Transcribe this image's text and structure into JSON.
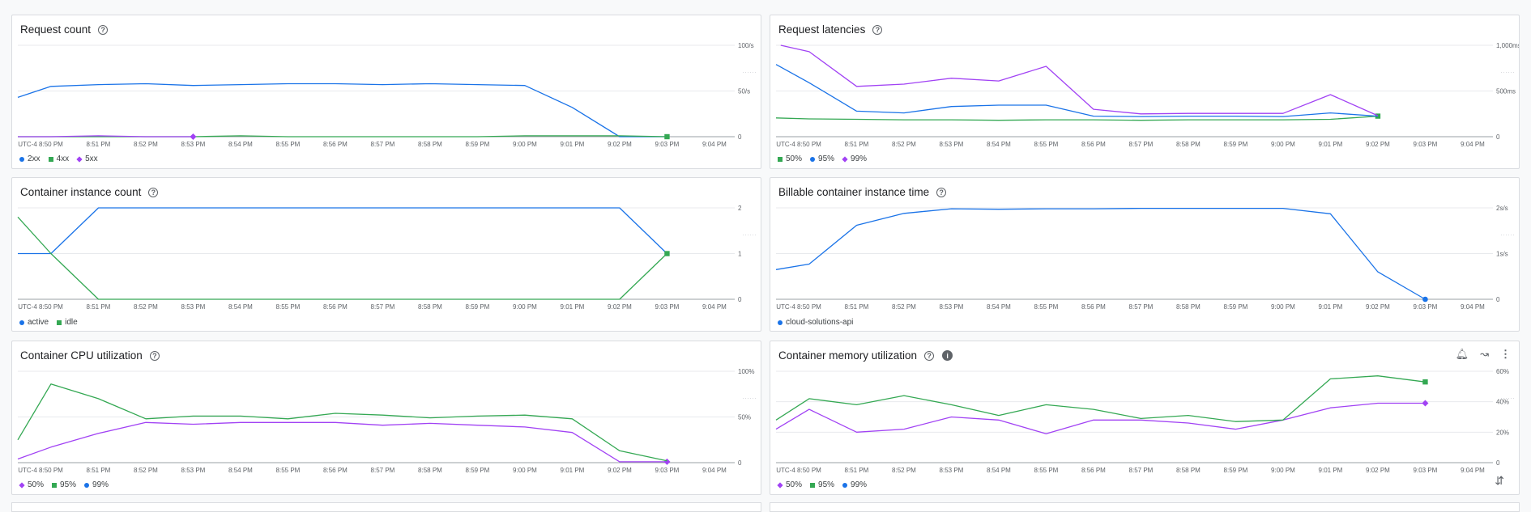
{
  "charts": [
    {
      "title": "Request count",
      "type": "line",
      "x_labels": [
        "UTC-4",
        "8:50 PM",
        "8:51 PM",
        "8:52 PM",
        "8:53 PM",
        "8:54 PM",
        "8:55 PM",
        "8:56 PM",
        "8:57 PM",
        "8:58 PM",
        "8:59 PM",
        "9:00 PM",
        "9:01 PM",
        "9:02 PM",
        "9:03 PM",
        "9:04 PM"
      ],
      "y_ticks": [
        {
          "v": 0,
          "label": "0"
        },
        {
          "v": 50,
          "label": "50/s"
        },
        {
          "v": 100,
          "label": "100/s"
        }
      ],
      "ylim": [
        0,
        100
      ],
      "series": [
        {
          "name": "2xx",
          "color": "#1a73e8",
          "marker": "circle",
          "x": [
            -0.8,
            0,
            1,
            2,
            3,
            4,
            5,
            6,
            7,
            8,
            9,
            10,
            11,
            12,
            13
          ],
          "y": [
            43,
            55,
            57,
            58,
            56,
            57,
            58,
            58,
            57,
            58,
            57,
            56,
            32,
            0,
            0
          ],
          "end_marker": false
        },
        {
          "name": "4xx",
          "color": "#34a853",
          "marker": "square",
          "x": [
            -0.8,
            0,
            1,
            2,
            3,
            4,
            5,
            6,
            7,
            8,
            9,
            10,
            11,
            12,
            13
          ],
          "y": [
            0,
            0,
            0,
            0,
            0,
            1,
            0,
            0,
            0,
            0,
            0,
            1,
            1,
            1,
            0
          ],
          "end_marker": true
        },
        {
          "name": "5xx",
          "color": "#a142f4",
          "marker": "diamond",
          "x": [
            -0.8,
            0,
            1,
            2,
            3
          ],
          "y": [
            0,
            0,
            1,
            0,
            0
          ],
          "end_marker": true
        }
      ]
    },
    {
      "title": "Request latencies",
      "type": "line",
      "x_labels": [
        "UTC-4",
        "8:50 PM",
        "8:51 PM",
        "8:52 PM",
        "8:53 PM",
        "8:54 PM",
        "8:55 PM",
        "8:56 PM",
        "8:57 PM",
        "8:58 PM",
        "8:59 PM",
        "9:00 PM",
        "9:01 PM",
        "9:02 PM",
        "9:03 PM",
        "9:04 PM"
      ],
      "y_ticks": [
        {
          "v": 0,
          "label": "0"
        },
        {
          "v": 500,
          "label": "500ms"
        },
        {
          "v": 1000,
          "label": "1,000ms"
        }
      ],
      "ylim": [
        0,
        1000
      ],
      "series": [
        {
          "name": "50%",
          "color": "#34a853",
          "marker": "square",
          "x": [
            -0.8,
            0,
            1,
            2,
            3,
            4,
            5,
            6,
            7,
            8,
            9,
            10,
            11,
            12
          ],
          "y": [
            205,
            195,
            190,
            185,
            185,
            180,
            185,
            185,
            180,
            185,
            185,
            185,
            190,
            225
          ],
          "end_marker": true
        },
        {
          "name": "95%",
          "color": "#1a73e8",
          "marker": "circle",
          "x": [
            -0.8,
            0,
            1,
            2,
            3,
            4,
            5,
            6,
            7,
            8,
            9,
            10,
            11,
            12
          ],
          "y": [
            790,
            590,
            280,
            260,
            330,
            345,
            345,
            225,
            220,
            225,
            225,
            220,
            260,
            225
          ],
          "end_marker": false
        },
        {
          "name": "99%",
          "color": "#a142f4",
          "marker": "diamond",
          "x": [
            -0.6,
            0,
            1,
            2,
            3,
            4,
            5,
            6,
            7,
            8,
            9,
            10,
            11,
            12
          ],
          "y": [
            1000,
            930,
            550,
            575,
            640,
            610,
            770,
            300,
            250,
            255,
            255,
            255,
            460,
            230
          ],
          "end_marker": false
        }
      ]
    },
    {
      "title": "Container instance count",
      "type": "line",
      "x_labels": [
        "UTC-4",
        "8:50 PM",
        "8:51 PM",
        "8:52 PM",
        "8:53 PM",
        "8:54 PM",
        "8:55 PM",
        "8:56 PM",
        "8:57 PM",
        "8:58 PM",
        "8:59 PM",
        "9:00 PM",
        "9:01 PM",
        "9:02 PM",
        "9:03 PM",
        "9:04 PM"
      ],
      "y_ticks": [
        {
          "v": 0,
          "label": "0"
        },
        {
          "v": 1,
          "label": "1"
        },
        {
          "v": 2,
          "label": "2"
        }
      ],
      "ylim": [
        0,
        2
      ],
      "series": [
        {
          "name": "active",
          "color": "#1a73e8",
          "marker": "circle",
          "x": [
            -0.8,
            0,
            1,
            2,
            3,
            4,
            5,
            6,
            7,
            8,
            9,
            10,
            11,
            12,
            13
          ],
          "y": [
            1,
            1,
            2,
            2,
            2,
            2,
            2,
            2,
            2,
            2,
            2,
            2,
            2,
            2,
            1
          ],
          "end_marker": false
        },
        {
          "name": "idle",
          "color": "#34a853",
          "marker": "square",
          "x": [
            -0.8,
            0,
            1,
            2,
            3,
            4,
            5,
            6,
            7,
            8,
            9,
            10,
            11,
            12,
            13
          ],
          "y": [
            1.8,
            1,
            0,
            0,
            0,
            0,
            0,
            0,
            0,
            0,
            0,
            0,
            0,
            0,
            1
          ],
          "end_marker": true
        }
      ]
    },
    {
      "title": "Billable container instance time",
      "type": "line",
      "x_labels": [
        "UTC-4",
        "8:50 PM",
        "8:51 PM",
        "8:52 PM",
        "8:53 PM",
        "8:54 PM",
        "8:55 PM",
        "8:56 PM",
        "8:57 PM",
        "8:58 PM",
        "8:59 PM",
        "9:00 PM",
        "9:01 PM",
        "9:02 PM",
        "9:03 PM",
        "9:04 PM"
      ],
      "y_ticks": [
        {
          "v": 0,
          "label": "0"
        },
        {
          "v": 1,
          "label": "1s/s"
        },
        {
          "v": 2,
          "label": "2s/s"
        }
      ],
      "ylim": [
        0,
        2
      ],
      "series": [
        {
          "name": "cloud-solutions-api",
          "color": "#1a73e8",
          "marker": "circle",
          "x": [
            -0.8,
            0,
            1,
            2,
            3,
            4,
            5,
            6,
            7,
            8,
            9,
            10,
            11,
            12,
            13
          ],
          "y": [
            0.65,
            0.77,
            1.62,
            1.88,
            1.98,
            1.97,
            1.98,
            1.98,
            1.99,
            1.99,
            1.99,
            1.99,
            1.87,
            0.6,
            0
          ],
          "end_marker": true
        }
      ]
    },
    {
      "title": "Container CPU utilization",
      "type": "line",
      "x_labels": [
        "UTC-4",
        "8:50 PM",
        "8:51 PM",
        "8:52 PM",
        "8:53 PM",
        "8:54 PM",
        "8:55 PM",
        "8:56 PM",
        "8:57 PM",
        "8:58 PM",
        "8:59 PM",
        "9:00 PM",
        "9:01 PM",
        "9:02 PM",
        "9:03 PM",
        "9:04 PM"
      ],
      "y_ticks": [
        {
          "v": 0,
          "label": "0"
        },
        {
          "v": 50,
          "label": "50%"
        },
        {
          "v": 100,
          "label": "100%"
        }
      ],
      "ylim": [
        0,
        100
      ],
      "series": [
        {
          "name": "50%",
          "color": "#a142f4",
          "marker": "diamond",
          "x": [
            -0.8,
            0,
            1,
            2,
            3,
            4,
            5,
            6,
            7,
            8,
            9,
            10,
            11,
            12,
            13
          ],
          "y": [
            4,
            17,
            32,
            44,
            42,
            44,
            44,
            44,
            41,
            43,
            41,
            39,
            33,
            1,
            1
          ],
          "end_marker": true
        },
        {
          "name": "95%",
          "color": "#34a853",
          "marker": "square",
          "x": [
            -0.8,
            0,
            1,
            2,
            3,
            4,
            5,
            6,
            7,
            8,
            9,
            10,
            11,
            12,
            13
          ],
          "y": [
            25,
            86,
            70,
            48,
            51,
            51,
            48,
            54,
            52,
            49,
            51,
            52,
            48,
            13,
            2
          ],
          "end_marker": false
        },
        {
          "name": "99%",
          "color": "#1a73e8",
          "marker": "circle",
          "x": [],
          "y": [],
          "end_marker": false
        }
      ]
    },
    {
      "title": "Container memory utilization",
      "type": "line",
      "x_labels": [
        "UTC-4",
        "8:50 PM",
        "8:51 PM",
        "8:52 PM",
        "8:53 PM",
        "8:54 PM",
        "8:55 PM",
        "8:56 PM",
        "8:57 PM",
        "8:58 PM",
        "8:59 PM",
        "9:00 PM",
        "9:01 PM",
        "9:02 PM",
        "9:03 PM",
        "9:04 PM"
      ],
      "y_ticks": [
        {
          "v": 0,
          "label": "0"
        },
        {
          "v": 20,
          "label": "20%"
        },
        {
          "v": 40,
          "label": "40%"
        },
        {
          "v": 60,
          "label": "60%"
        }
      ],
      "ylim": [
        0,
        60
      ],
      "series": [
        {
          "name": "50%",
          "color": "#a142f4",
          "marker": "diamond",
          "x": [
            -0.8,
            0,
            1,
            2,
            3,
            4,
            5,
            6,
            7,
            8,
            9,
            10,
            11,
            12,
            13
          ],
          "y": [
            22,
            35,
            20,
            22,
            30,
            28,
            19,
            28,
            28,
            26,
            22,
            28,
            36,
            39,
            39
          ],
          "end_marker": true
        },
        {
          "name": "95%",
          "color": "#34a853",
          "marker": "square",
          "x": [
            -0.8,
            0,
            1,
            2,
            3,
            4,
            5,
            6,
            7,
            8,
            9,
            10,
            11,
            12,
            13
          ],
          "y": [
            28,
            42,
            38,
            44,
            38,
            31,
            38,
            35,
            29,
            31,
            27,
            28,
            55,
            57,
            53
          ],
          "end_marker": true
        },
        {
          "name": "99%",
          "color": "#1a73e8",
          "marker": "circle",
          "x": [],
          "y": [],
          "end_marker": false
        }
      ]
    }
  ],
  "colors": {
    "grid": "#e8eaed",
    "axis": "#5f6368",
    "label": "#5f6368"
  }
}
